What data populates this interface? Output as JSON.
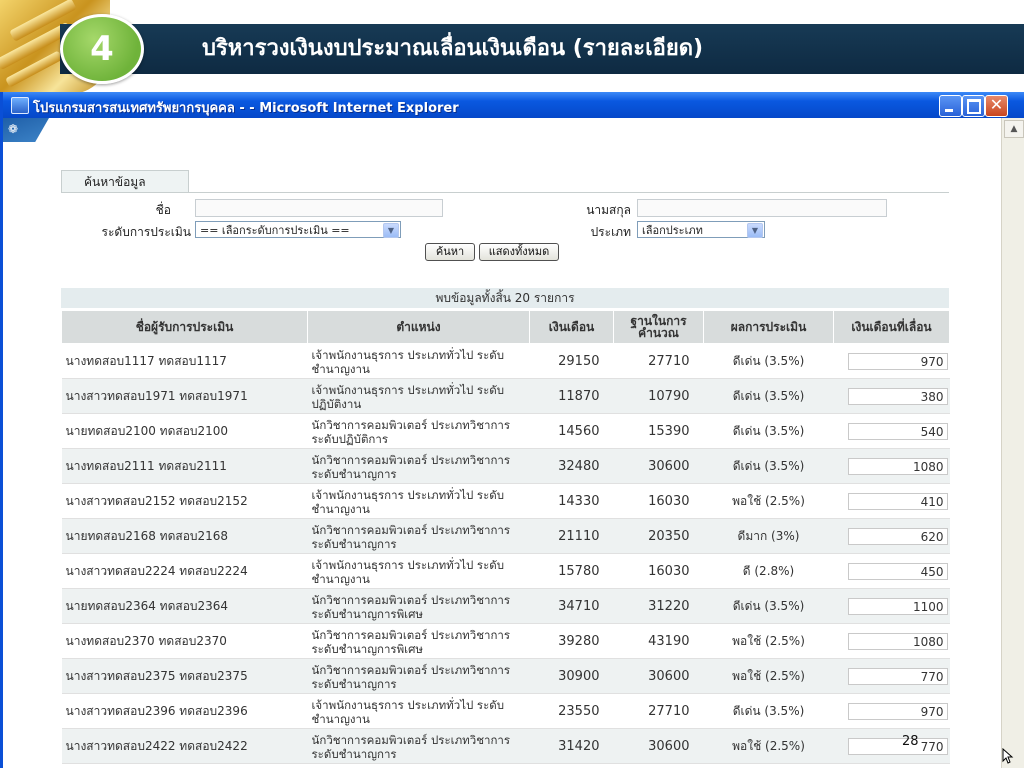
{
  "slide": {
    "number": "4",
    "title": "บริหารวงเงินงบประมาณเลื่อนเงินเดือน (รายละเอียด)",
    "page_number": "28"
  },
  "window": {
    "title": "โปรแกรมสารสนเทศทรัพยากรบุคคล - - Microsoft Internet Explorer",
    "close_glyph": "✕"
  },
  "search": {
    "tab_label": "ค้นหาข้อมูล",
    "first_name_label": "ชื่อ",
    "last_name_label": "นามสกุล",
    "level_label": "ระดับการประเมิน",
    "level_selected": "== เลือกระดับการประเมิน ==",
    "type_label": "ประเภท",
    "type_selected": "เลือกประเภท",
    "search_button": "ค้นหา",
    "show_all_button": "แสดงทั้งหมด",
    "arrow_glyph": "▼"
  },
  "results": {
    "found_text": "พบข้อมูลทั้งสิ้น 20 รายการ",
    "headers": {
      "name": "ชื่อผู้รับการประเมิน",
      "position": "ตำแหน่ง",
      "salary": "เงินเดือน",
      "base": "ฐานในการคำนวณ",
      "result": "ผลการประเมิน",
      "increase": "เงินเดือนที่เลื่อน"
    },
    "rows": [
      {
        "name": "นางทดสอบ1117 ทดสอบ1117",
        "position": "เจ้าพนักงานธุรการ ประเภททั่วไป ระดับชำนาญงาน",
        "salary": "29150",
        "base": "27710",
        "result": "ดีเด่น (3.5%)",
        "increase": "970"
      },
      {
        "name": "นางสาวทดสอบ1971 ทดสอบ1971",
        "position": "เจ้าพนักงานธุรการ ประเภททั่วไป ระดับปฏิบัติงาน",
        "salary": "11870",
        "base": "10790",
        "result": "ดีเด่น (3.5%)",
        "increase": "380"
      },
      {
        "name": "นายทดสอบ2100 ทดสอบ2100",
        "position": "นักวิชาการคอมพิวเตอร์ ประเภทวิชาการ ระดับปฏิบัติการ",
        "salary": "14560",
        "base": "15390",
        "result": "ดีเด่น (3.5%)",
        "increase": "540"
      },
      {
        "name": "นางทดสอบ2111 ทดสอบ2111",
        "position": "นักวิชาการคอมพิวเตอร์ ประเภทวิชาการ ระดับชำนาญการ",
        "salary": "32480",
        "base": "30600",
        "result": "ดีเด่น (3.5%)",
        "increase": "1080"
      },
      {
        "name": "นางสาวทดสอบ2152 ทดสอบ2152",
        "position": "เจ้าพนักงานธุรการ ประเภททั่วไป ระดับชำนาญงาน",
        "salary": "14330",
        "base": "16030",
        "result": "พอใช้ (2.5%)",
        "increase": "410"
      },
      {
        "name": "นายทดสอบ2168 ทดสอบ2168",
        "position": "นักวิชาการคอมพิวเตอร์ ประเภทวิชาการ ระดับชำนาญการ",
        "salary": "21110",
        "base": "20350",
        "result": "ดีมาก (3%)",
        "increase": "620"
      },
      {
        "name": "นางสาวทดสอบ2224 ทดสอบ2224",
        "position": "เจ้าพนักงานธุรการ ประเภททั่วไป ระดับชำนาญงาน",
        "salary": "15780",
        "base": "16030",
        "result": "ดี (2.8%)",
        "increase": "450"
      },
      {
        "name": "นายทดสอบ2364 ทดสอบ2364",
        "position": "นักวิชาการคอมพิวเตอร์ ประเภทวิชาการ ระดับชำนาญการพิเศษ",
        "salary": "34710",
        "base": "31220",
        "result": "ดีเด่น (3.5%)",
        "increase": "1100"
      },
      {
        "name": "นางทดสอบ2370 ทดสอบ2370",
        "position": "นักวิชาการคอมพิวเตอร์ ประเภทวิชาการ ระดับชำนาญการพิเศษ",
        "salary": "39280",
        "base": "43190",
        "result": "พอใช้ (2.5%)",
        "increase": "1080"
      },
      {
        "name": "นางสาวทดสอบ2375 ทดสอบ2375",
        "position": "นักวิชาการคอมพิวเตอร์ ประเภทวิชาการ ระดับชำนาญการ",
        "salary": "30900",
        "base": "30600",
        "result": "พอใช้ (2.5%)",
        "increase": "770"
      },
      {
        "name": "นางสาวทดสอบ2396 ทดสอบ2396",
        "position": "เจ้าพนักงานธุรการ ประเภททั่วไป ระดับชำนาญงาน",
        "salary": "23550",
        "base": "27710",
        "result": "ดีเด่น (3.5%)",
        "increase": "970"
      },
      {
        "name": "นางสาวทดสอบ2422 ทดสอบ2422",
        "position": "นักวิชาการคอมพิวเตอร์ ประเภทวิชาการ ระดับชำนาญการ",
        "salary": "31420",
        "base": "30600",
        "result": "พอใช้ (2.5%)",
        "increase": "770"
      }
    ]
  }
}
